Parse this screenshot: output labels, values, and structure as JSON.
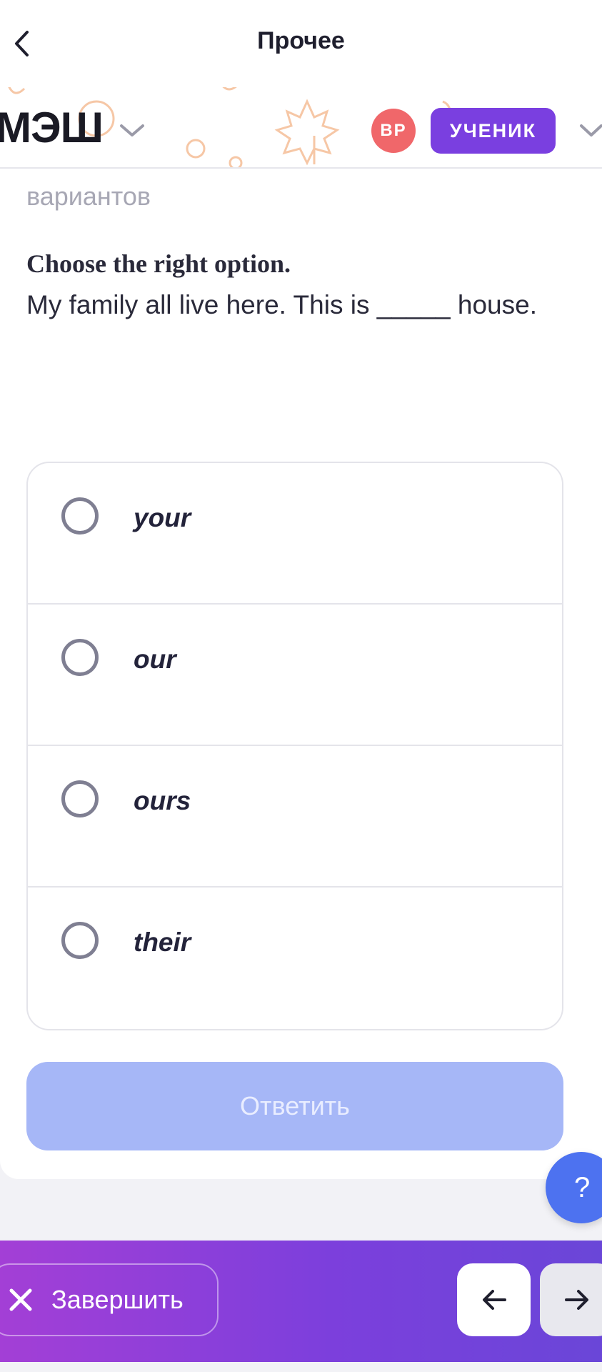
{
  "header": {
    "title": "Прочее",
    "back_icon": "chevron-left-icon"
  },
  "brand": {
    "logo": "МЭШ",
    "avatar_initials": "ВР",
    "role": "УЧЕНИК",
    "colors": {
      "avatar": "#f0676a",
      "role_badge": "#7a3fe0"
    }
  },
  "question": {
    "hint_tail": "вариантов",
    "instruction": "Choose the right option.",
    "text": "My family all live here. This is _____ house."
  },
  "options": [
    {
      "label": "your"
    },
    {
      "label": "our"
    },
    {
      "label": "ours"
    },
    {
      "label": "their"
    }
  ],
  "submit_label": "Ответить",
  "help_label": "?",
  "footer": {
    "finish_label": "Завершить",
    "prev_icon": "arrow-left-icon",
    "next_icon": "arrow-right-icon"
  },
  "colors": {
    "accent": "#4d72f0",
    "submit_disabled": "#a6b7f7",
    "footer_gradient_start": "#a33fd6",
    "footer_gradient_end": "#6a46d8"
  }
}
